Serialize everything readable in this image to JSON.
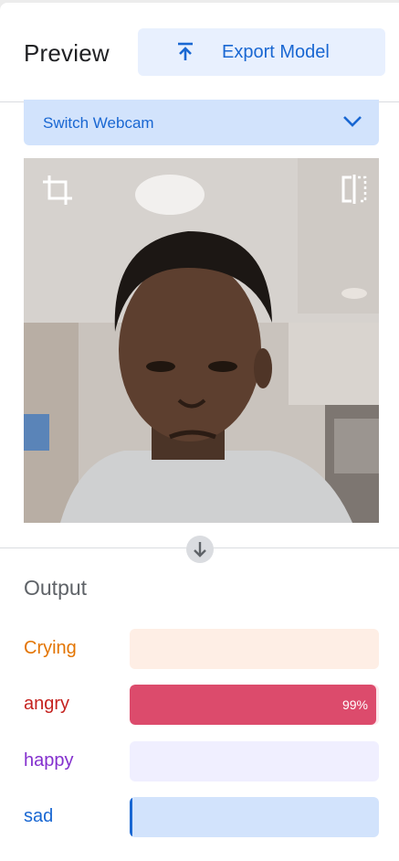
{
  "preview": {
    "title": "Preview",
    "export_label": "Export Model",
    "export_icon": "upload-icon"
  },
  "input_select": {
    "selected": "Switch Webcam",
    "icon": "chevron-down-icon"
  },
  "webcam": {
    "crop_icon": "crop-icon",
    "flip_icon": "flip-icon"
  },
  "output": {
    "title": "Output",
    "classes": [
      {
        "label": "Crying",
        "value": 0.0,
        "pct_text": "",
        "label_color": "#e37400",
        "track_color": "#feeee5",
        "fill_color": "#f29900"
      },
      {
        "label": "angry",
        "value": 0.99,
        "pct_text": "99%",
        "label_color": "#c5221f",
        "track_color": "#fce8ec",
        "fill_color": "#dc4b6c"
      },
      {
        "label": "happy",
        "value": 0.0,
        "pct_text": "",
        "label_color": "#8430ce",
        "track_color": "#f0efff",
        "fill_color": "#a142f4"
      },
      {
        "label": "sad",
        "value": 0.01,
        "pct_text": "",
        "label_color": "#1967d2",
        "track_color": "#d2e3fc",
        "fill_color": "#1967d2"
      }
    ]
  }
}
